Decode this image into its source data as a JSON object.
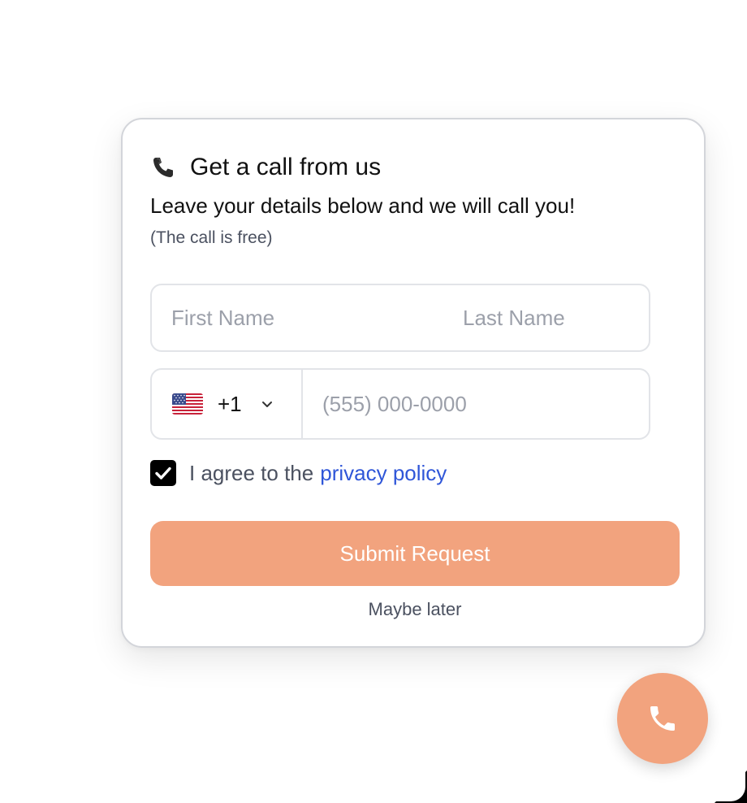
{
  "card": {
    "title": "Get a call from us",
    "subtitle": "Leave your details below and we will call you!",
    "note": "(The call is free)",
    "title_icon": "telephone-icon"
  },
  "form": {
    "first_name_placeholder": "First Name",
    "last_name_placeholder": "Last Name",
    "first_name_value": "",
    "last_name_value": "",
    "country_flag": "us-flag-icon",
    "dial_code": "+1",
    "phone_placeholder": "(555) 000-0000",
    "phone_value": "",
    "agree_checked": true,
    "agree_text": "I agree to the",
    "agree_link": "privacy policy",
    "submit_label": "Submit Request",
    "dismiss_label": "Maybe later"
  },
  "fab": {
    "icon": "phone-icon"
  },
  "colors": {
    "accent": "#f2a37e",
    "link": "#2f56d8",
    "border": "#e2e4e8",
    "muted_text": "#4b5160",
    "placeholder": "#9ca0aa"
  }
}
